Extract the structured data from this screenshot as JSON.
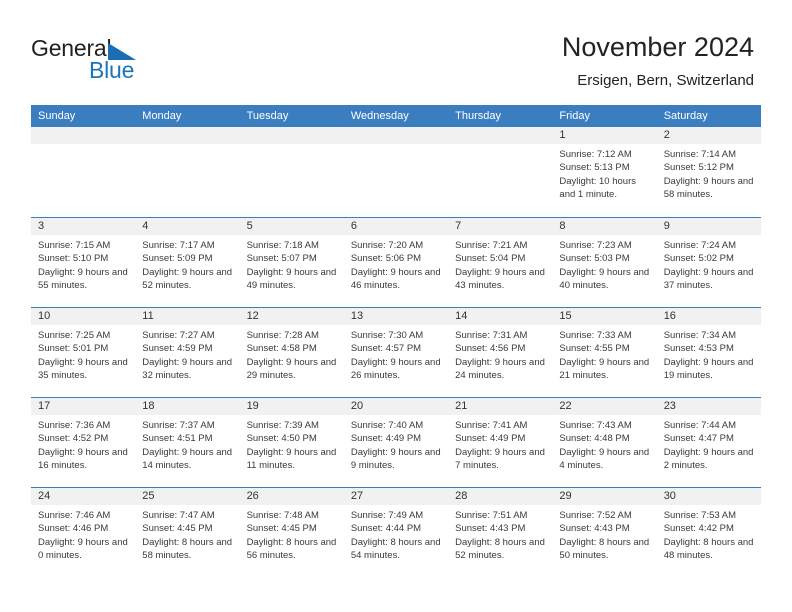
{
  "brand": {
    "line1": "General",
    "line2": "Blue",
    "flag_color": "#1b6eb3"
  },
  "header": {
    "title": "November 2024",
    "subtitle": "Ersigen, Bern, Switzerland"
  },
  "colors": {
    "header_blue": "#3b7ec0",
    "daynum_band": "#f1f1f1",
    "text": "#333333"
  },
  "weekdays": [
    "Sunday",
    "Monday",
    "Tuesday",
    "Wednesday",
    "Thursday",
    "Friday",
    "Saturday"
  ],
  "weeks": [
    [
      {
        "day": "",
        "sunrise": "",
        "sunset": "",
        "daylight": "",
        "empty": true
      },
      {
        "day": "",
        "sunrise": "",
        "sunset": "",
        "daylight": "",
        "empty": true
      },
      {
        "day": "",
        "sunrise": "",
        "sunset": "",
        "daylight": "",
        "empty": true
      },
      {
        "day": "",
        "sunrise": "",
        "sunset": "",
        "daylight": "",
        "empty": true
      },
      {
        "day": "",
        "sunrise": "",
        "sunset": "",
        "daylight": "",
        "empty": true
      },
      {
        "day": "1",
        "sunrise": "Sunrise: 7:12 AM",
        "sunset": "Sunset: 5:13 PM",
        "daylight": "Daylight: 10 hours and 1 minute."
      },
      {
        "day": "2",
        "sunrise": "Sunrise: 7:14 AM",
        "sunset": "Sunset: 5:12 PM",
        "daylight": "Daylight: 9 hours and 58 minutes."
      }
    ],
    [
      {
        "day": "3",
        "sunrise": "Sunrise: 7:15 AM",
        "sunset": "Sunset: 5:10 PM",
        "daylight": "Daylight: 9 hours and 55 minutes."
      },
      {
        "day": "4",
        "sunrise": "Sunrise: 7:17 AM",
        "sunset": "Sunset: 5:09 PM",
        "daylight": "Daylight: 9 hours and 52 minutes."
      },
      {
        "day": "5",
        "sunrise": "Sunrise: 7:18 AM",
        "sunset": "Sunset: 5:07 PM",
        "daylight": "Daylight: 9 hours and 49 minutes."
      },
      {
        "day": "6",
        "sunrise": "Sunrise: 7:20 AM",
        "sunset": "Sunset: 5:06 PM",
        "daylight": "Daylight: 9 hours and 46 minutes."
      },
      {
        "day": "7",
        "sunrise": "Sunrise: 7:21 AM",
        "sunset": "Sunset: 5:04 PM",
        "daylight": "Daylight: 9 hours and 43 minutes."
      },
      {
        "day": "8",
        "sunrise": "Sunrise: 7:23 AM",
        "sunset": "Sunset: 5:03 PM",
        "daylight": "Daylight: 9 hours and 40 minutes."
      },
      {
        "day": "9",
        "sunrise": "Sunrise: 7:24 AM",
        "sunset": "Sunset: 5:02 PM",
        "daylight": "Daylight: 9 hours and 37 minutes."
      }
    ],
    [
      {
        "day": "10",
        "sunrise": "Sunrise: 7:25 AM",
        "sunset": "Sunset: 5:01 PM",
        "daylight": "Daylight: 9 hours and 35 minutes."
      },
      {
        "day": "11",
        "sunrise": "Sunrise: 7:27 AM",
        "sunset": "Sunset: 4:59 PM",
        "daylight": "Daylight: 9 hours and 32 minutes."
      },
      {
        "day": "12",
        "sunrise": "Sunrise: 7:28 AM",
        "sunset": "Sunset: 4:58 PM",
        "daylight": "Daylight: 9 hours and 29 minutes."
      },
      {
        "day": "13",
        "sunrise": "Sunrise: 7:30 AM",
        "sunset": "Sunset: 4:57 PM",
        "daylight": "Daylight: 9 hours and 26 minutes."
      },
      {
        "day": "14",
        "sunrise": "Sunrise: 7:31 AM",
        "sunset": "Sunset: 4:56 PM",
        "daylight": "Daylight: 9 hours and 24 minutes."
      },
      {
        "day": "15",
        "sunrise": "Sunrise: 7:33 AM",
        "sunset": "Sunset: 4:55 PM",
        "daylight": "Daylight: 9 hours and 21 minutes."
      },
      {
        "day": "16",
        "sunrise": "Sunrise: 7:34 AM",
        "sunset": "Sunset: 4:53 PM",
        "daylight": "Daylight: 9 hours and 19 minutes."
      }
    ],
    [
      {
        "day": "17",
        "sunrise": "Sunrise: 7:36 AM",
        "sunset": "Sunset: 4:52 PM",
        "daylight": "Daylight: 9 hours and 16 minutes."
      },
      {
        "day": "18",
        "sunrise": "Sunrise: 7:37 AM",
        "sunset": "Sunset: 4:51 PM",
        "daylight": "Daylight: 9 hours and 14 minutes."
      },
      {
        "day": "19",
        "sunrise": "Sunrise: 7:39 AM",
        "sunset": "Sunset: 4:50 PM",
        "daylight": "Daylight: 9 hours and 11 minutes."
      },
      {
        "day": "20",
        "sunrise": "Sunrise: 7:40 AM",
        "sunset": "Sunset: 4:49 PM",
        "daylight": "Daylight: 9 hours and 9 minutes."
      },
      {
        "day": "21",
        "sunrise": "Sunrise: 7:41 AM",
        "sunset": "Sunset: 4:49 PM",
        "daylight": "Daylight: 9 hours and 7 minutes."
      },
      {
        "day": "22",
        "sunrise": "Sunrise: 7:43 AM",
        "sunset": "Sunset: 4:48 PM",
        "daylight": "Daylight: 9 hours and 4 minutes."
      },
      {
        "day": "23",
        "sunrise": "Sunrise: 7:44 AM",
        "sunset": "Sunset: 4:47 PM",
        "daylight": "Daylight: 9 hours and 2 minutes."
      }
    ],
    [
      {
        "day": "24",
        "sunrise": "Sunrise: 7:46 AM",
        "sunset": "Sunset: 4:46 PM",
        "daylight": "Daylight: 9 hours and 0 minutes."
      },
      {
        "day": "25",
        "sunrise": "Sunrise: 7:47 AM",
        "sunset": "Sunset: 4:45 PM",
        "daylight": "Daylight: 8 hours and 58 minutes."
      },
      {
        "day": "26",
        "sunrise": "Sunrise: 7:48 AM",
        "sunset": "Sunset: 4:45 PM",
        "daylight": "Daylight: 8 hours and 56 minutes."
      },
      {
        "day": "27",
        "sunrise": "Sunrise: 7:49 AM",
        "sunset": "Sunset: 4:44 PM",
        "daylight": "Daylight: 8 hours and 54 minutes."
      },
      {
        "day": "28",
        "sunrise": "Sunrise: 7:51 AM",
        "sunset": "Sunset: 4:43 PM",
        "daylight": "Daylight: 8 hours and 52 minutes."
      },
      {
        "day": "29",
        "sunrise": "Sunrise: 7:52 AM",
        "sunset": "Sunset: 4:43 PM",
        "daylight": "Daylight: 8 hours and 50 minutes."
      },
      {
        "day": "30",
        "sunrise": "Sunrise: 7:53 AM",
        "sunset": "Sunset: 4:42 PM",
        "daylight": "Daylight: 8 hours and 48 minutes."
      }
    ]
  ]
}
